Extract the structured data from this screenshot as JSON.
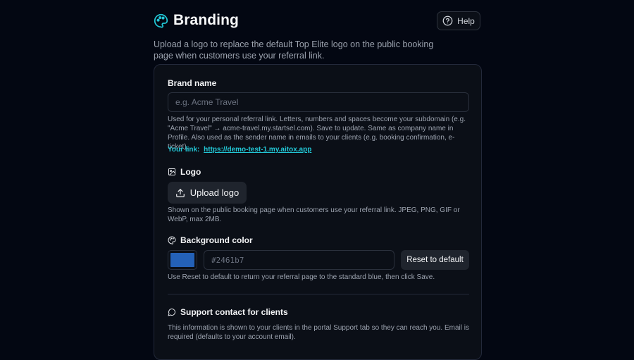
{
  "header": {
    "title": "Branding",
    "icon": "palette-icon",
    "subtitle": "Upload a logo to replace the default Top Elite logo on the public booking page when customers use your referral link.",
    "help_label": "Help"
  },
  "colors": {
    "accent": "#22c7d6",
    "background": "#030712",
    "card": "#0b0f17",
    "brand_swatch": "#2461b7"
  },
  "brand_name": {
    "label": "Brand name",
    "placeholder": "e.g. Acme Travel",
    "value": "",
    "help": "Used for your personal referral link. Letters, numbers and spaces become your subdomain (e.g. \"Acme Travel\" → acme-travel.my.startsel.com). Save to update. Same as company name in Profile. Also used as the sender name in emails to your clients (e.g. booking confirmation, e-ticket).",
    "link_label": "Your link:",
    "link_url": "https://demo-test-1.my.aitox.app"
  },
  "logo": {
    "label": "Logo",
    "upload_label": "Upload logo",
    "help": "Shown on the public booking page when customers use your referral link. JPEG, PNG, GIF or WebP, max 2MB."
  },
  "background_color": {
    "label": "Background color",
    "placeholder": "#2461b7",
    "value": "",
    "reset_label": "Reset to default",
    "help": "Use Reset to default to return your referral page to the standard blue, then click Save."
  },
  "support": {
    "label": "Support contact for clients",
    "help": "This information is shown to your clients in the portal Support tab so they can reach you. Email is required (defaults to your account email)."
  }
}
